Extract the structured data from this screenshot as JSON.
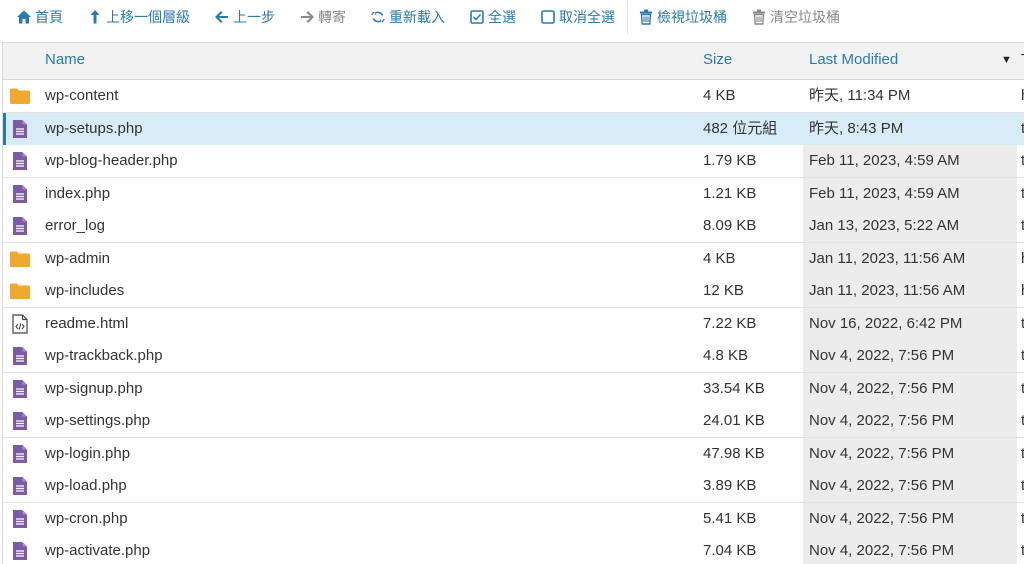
{
  "toolbar": {
    "items": [
      {
        "label": "首頁",
        "icon": "home-icon",
        "disabled": false
      },
      {
        "label": "上移一個層級",
        "icon": "level-up-icon",
        "disabled": false
      },
      {
        "label": "上一步",
        "icon": "arrow-left-icon",
        "disabled": false
      },
      {
        "label": "轉寄",
        "icon": "arrow-right-icon",
        "disabled": true
      },
      {
        "label": "重新載入",
        "icon": "reload-icon",
        "disabled": false
      },
      {
        "label": "全選",
        "icon": "checkbox-checked-icon",
        "disabled": false
      },
      {
        "label": "取消全選",
        "icon": "checkbox-empty-icon",
        "disabled": false
      },
      {
        "label": "檢視垃圾桶",
        "icon": "trash-icon",
        "disabled": false
      },
      {
        "label": "清空垃圾桶",
        "icon": "trash-icon",
        "disabled": true
      }
    ]
  },
  "table": {
    "columns": {
      "name": "Name",
      "size": "Size",
      "modified": "Last Modified",
      "type": "T"
    },
    "sort_indicator": "▼",
    "rows": [
      {
        "name": "wp-content",
        "size": "4 KB",
        "modified": "昨天, 11:34 PM",
        "type": "h",
        "kind": "folder",
        "selected": false
      },
      {
        "name": "wp-setups.php",
        "size": "482 位元組",
        "modified": "昨天, 8:43 PM",
        "type": "t",
        "kind": "file",
        "selected": true
      },
      {
        "name": "wp-blog-header.php",
        "size": "1.79 KB",
        "modified": "Feb 11, 2023, 4:59 AM",
        "type": "t",
        "kind": "file",
        "selected": false
      },
      {
        "name": "index.php",
        "size": "1.21 KB",
        "modified": "Feb 11, 2023, 4:59 AM",
        "type": "t",
        "kind": "file",
        "selected": false
      },
      {
        "name": "error_log",
        "size": "8.09 KB",
        "modified": "Jan 13, 2023, 5:22 AM",
        "type": "t",
        "kind": "file",
        "selected": false
      },
      {
        "name": "wp-admin",
        "size": "4 KB",
        "modified": "Jan 11, 2023, 11:56 AM",
        "type": "h",
        "kind": "folder",
        "selected": false
      },
      {
        "name": "wp-includes",
        "size": "12 KB",
        "modified": "Jan 11, 2023, 11:56 AM",
        "type": "h",
        "kind": "folder",
        "selected": false
      },
      {
        "name": "readme.html",
        "size": "7.22 KB",
        "modified": "Nov 16, 2022, 6:42 PM",
        "type": "t",
        "kind": "html",
        "selected": false
      },
      {
        "name": "wp-trackback.php",
        "size": "4.8 KB",
        "modified": "Nov 4, 2022, 7:56 PM",
        "type": "t",
        "kind": "file",
        "selected": false
      },
      {
        "name": "wp-signup.php",
        "size": "33.54 KB",
        "modified": "Nov 4, 2022, 7:56 PM",
        "type": "t",
        "kind": "file",
        "selected": false
      },
      {
        "name": "wp-settings.php",
        "size": "24.01 KB",
        "modified": "Nov 4, 2022, 7:56 PM",
        "type": "t",
        "kind": "file",
        "selected": false
      },
      {
        "name": "wp-login.php",
        "size": "47.98 KB",
        "modified": "Nov 4, 2022, 7:56 PM",
        "type": "t",
        "kind": "file",
        "selected": false
      },
      {
        "name": "wp-load.php",
        "size": "3.89 KB",
        "modified": "Nov 4, 2022, 7:56 PM",
        "type": "t",
        "kind": "file",
        "selected": false
      },
      {
        "name": "wp-cron.php",
        "size": "5.41 KB",
        "modified": "Nov 4, 2022, 7:56 PM",
        "type": "t",
        "kind": "file",
        "selected": false
      },
      {
        "name": "wp-activate.php",
        "size": "7.04 KB",
        "modified": "Nov 4, 2022, 7:56 PM",
        "type": "t",
        "kind": "file",
        "selected": false
      }
    ]
  },
  "colors": {
    "link": "#2a7ab0",
    "folder": "#f0a830",
    "file": "#7b5aa6",
    "selected": "#d8ecf7"
  }
}
